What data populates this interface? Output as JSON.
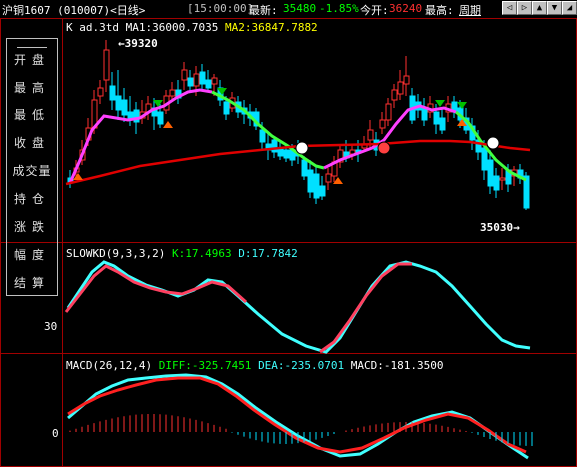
{
  "header": {
    "symbol": "沪铜1607 (010007)<日线>",
    "time": "[15:00:00]",
    "latest_label": "最新:",
    "latest_value": "35480",
    "change": "-1.85%",
    "open_label": "今开:",
    "open_value": "36240",
    "high_label": "最高:",
    "period": "周期",
    "nav_buttons": [
      "◁",
      "▷",
      "▲",
      "▼",
      "◢"
    ]
  },
  "left_menu": {
    "items": [
      "开盘",
      "最高",
      "最低",
      "收盘",
      "成交量",
      "持仓",
      "涨跌",
      "幅度",
      "结算"
    ]
  },
  "kline": {
    "label_k": "K",
    "adj": "ad.3td",
    "ma1": "MA1:36000.7035",
    "ma2": "MA2:36847.7882",
    "high_marker": "39320",
    "low_marker": "35030"
  },
  "kd": {
    "title": "SLOWKD(9,3,3,2)",
    "k": "K:17.4963",
    "d": "D:17.7842",
    "axis_label": "30"
  },
  "macd": {
    "title": "MACD(26,12,4)",
    "diff": "DIFF:-325.7451",
    "dea": "DEA:-235.0701",
    "macd": "MACD:-181.3500",
    "axis_label": "0"
  },
  "colors": {
    "up": "#ff3030",
    "down": "#00e0ff",
    "ma1_up": "#ff40ff",
    "ma1_down": "#40ff40",
    "ma2": "#e00000",
    "kd_k": "#40ffff",
    "kd_d": "#ff4060",
    "diff": "#40ffff",
    "dea": "#ff2020"
  }
}
